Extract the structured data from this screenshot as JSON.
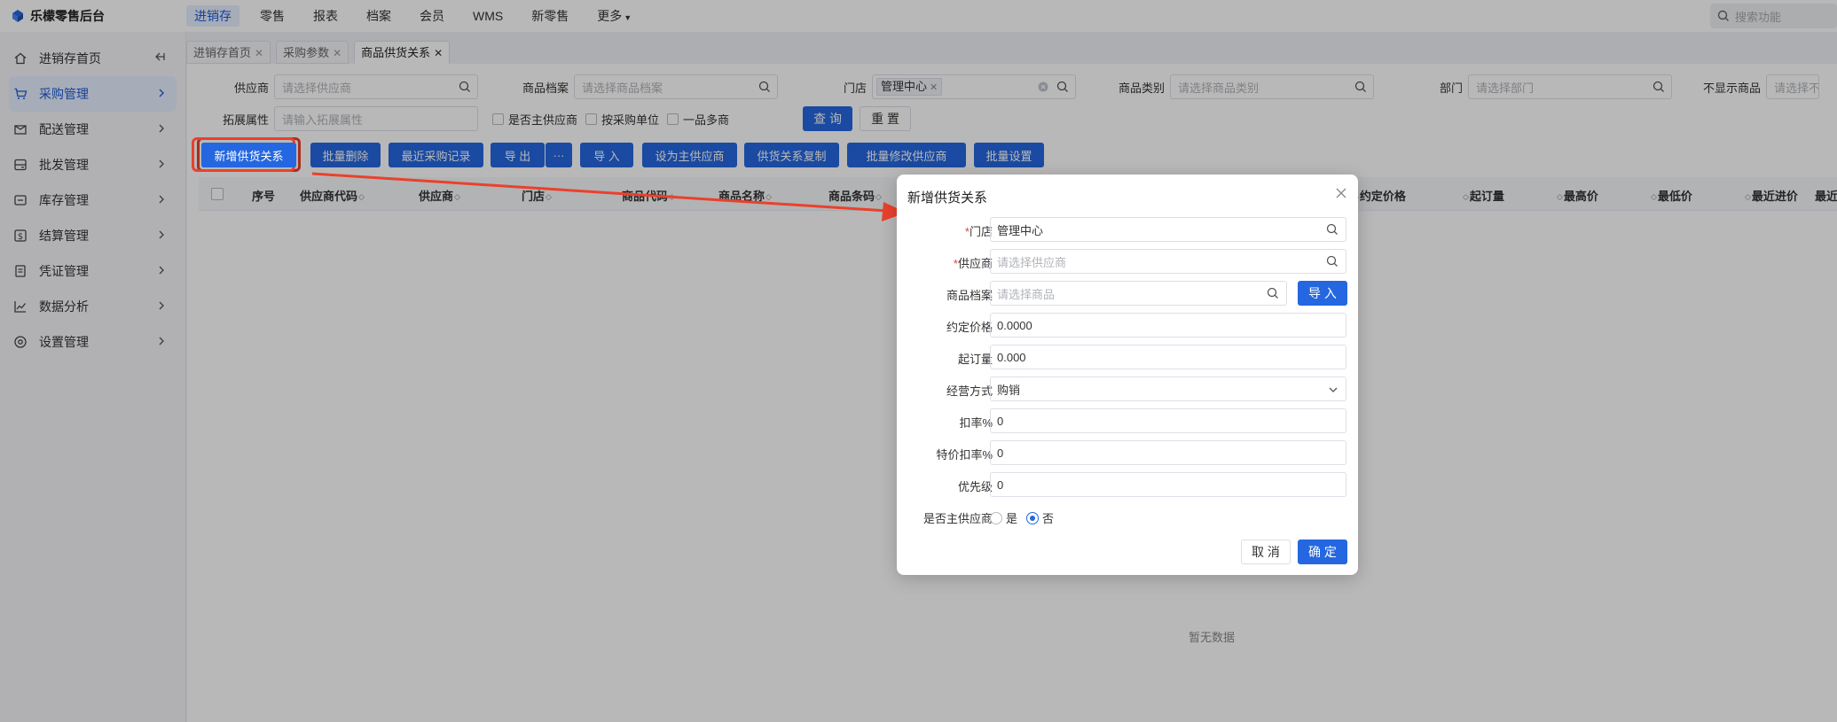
{
  "app": {
    "title": "乐檬零售后台"
  },
  "topnav": {
    "items": [
      {
        "label": "进销存",
        "active": true
      },
      {
        "label": "零售",
        "active": false
      },
      {
        "label": "报表",
        "active": false
      },
      {
        "label": "档案",
        "active": false
      },
      {
        "label": "会员",
        "active": false
      },
      {
        "label": "WMS",
        "active": false
      },
      {
        "label": "新零售",
        "active": false
      },
      {
        "label": "更多",
        "active": false
      }
    ],
    "search_placeholder": "搜索功能"
  },
  "sidebar": {
    "items": [
      {
        "label": "进销存首页",
        "icon": "home-icon"
      },
      {
        "label": "采购管理",
        "icon": "cart-icon",
        "active": true
      },
      {
        "label": "配送管理",
        "icon": "package-icon"
      },
      {
        "label": "批发管理",
        "icon": "server-icon"
      },
      {
        "label": "库存管理",
        "icon": "box-icon"
      },
      {
        "label": "结算管理",
        "icon": "dollar-icon"
      },
      {
        "label": "凭证管理",
        "icon": "document-icon"
      },
      {
        "label": "数据分析",
        "icon": "chart-icon"
      },
      {
        "label": "设置管理",
        "icon": "gear-icon"
      }
    ]
  },
  "tabs": [
    {
      "label": "进销存首页"
    },
    {
      "label": "采购参数"
    },
    {
      "label": "商品供货关系",
      "active": true
    }
  ],
  "filters": {
    "supplier": {
      "label": "供应商",
      "placeholder": "请选择供应商"
    },
    "product": {
      "label": "商品档案",
      "placeholder": "请选择商品档案"
    },
    "store": {
      "label": "门店",
      "tag": "管理中心"
    },
    "category": {
      "label": "商品类别",
      "placeholder": "请选择商品类别"
    },
    "dept": {
      "label": "部门",
      "placeholder": "请选择部门"
    },
    "hide_product": {
      "label": "不显示商品",
      "placeholder": "请选择不显"
    },
    "ext": {
      "label": "拓展属性",
      "placeholder": "请输入拓展属性"
    },
    "checkboxes": [
      "是否主供应商",
      "按采购单位",
      "一品多商"
    ],
    "query_btn": "查 询",
    "reset_btn": "重 置"
  },
  "actions": {
    "add": "新增供货关系",
    "batch_delete": "批量删除",
    "recent": "最近采购记录",
    "export": "导 出",
    "more": "···",
    "import": "导 入",
    "set_main": "设为主供应商",
    "copy": "供货关系复制",
    "batch_modify": "批量修改供应商",
    "batch_set": "批量设置"
  },
  "table": {
    "headers": [
      "序号",
      "供应商代码",
      "供应商",
      "门店",
      "商品代码",
      "商品名称",
      "商品条码",
      "约定价格",
      "起订量",
      "最高价",
      "最低价",
      "最近进价",
      "最近"
    ],
    "empty_text": "暂无数据"
  },
  "modal": {
    "title": "新增供货关系",
    "fields": {
      "store": {
        "label": "门店",
        "value": "管理中心"
      },
      "supplier": {
        "label": "供应商",
        "placeholder": "请选择供应商"
      },
      "product": {
        "label": "商品档案",
        "placeholder": "请选择商品"
      },
      "import_btn": "导 入",
      "agreed_price": {
        "label": "约定价格",
        "value": "0.0000"
      },
      "moq": {
        "label": "起订量",
        "value": "0.000"
      },
      "mode": {
        "label": "经营方式",
        "value": "购销"
      },
      "discount": {
        "label": "扣率%",
        "value": "0"
      },
      "special_discount": {
        "label": "特价扣率%",
        "value": "0"
      },
      "priority": {
        "label": "优先级",
        "value": "0"
      },
      "is_main": {
        "label": "是否主供应商",
        "options": [
          "是",
          "否"
        ],
        "selected": "否"
      }
    },
    "cancel": "取 消",
    "ok": "确 定"
  },
  "colors": {
    "primary": "#2467e0",
    "annotation": "#e9412c"
  }
}
